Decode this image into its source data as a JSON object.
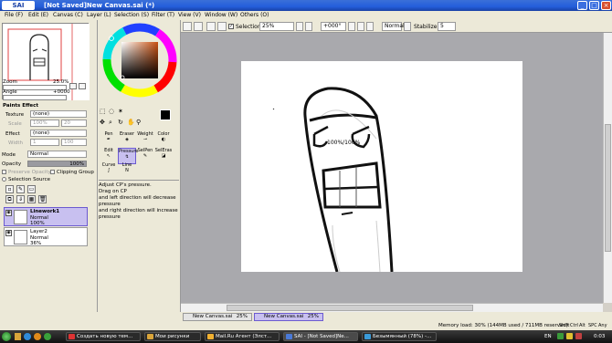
{
  "window": {
    "logo": "SAI",
    "title": "[Not Saved]New Canvas.sai (*)",
    "controls": [
      "_",
      "□",
      "×"
    ]
  },
  "menu": [
    "File (F)",
    "Edit (E)",
    "Canvas (C)",
    "Layer (L)",
    "Selection (S)",
    "Filter (T)",
    "View (V)",
    "Window (W)",
    "Others (O)"
  ],
  "navigator": {
    "zoom_label": "Zoom",
    "zoom_value": "25.0%",
    "angle_label": "Angle",
    "angle_value": "+0000"
  },
  "paint_effect": {
    "header": "Paints Effect",
    "texture_label": "Texture",
    "texture_value": "(none)",
    "scale_label": "Scale",
    "scale_value": "100%",
    "scale_num": "20",
    "effect_label": "Effect",
    "effect_value": "(none)",
    "width_label": "Width",
    "width_value": "1",
    "width_num": "100"
  },
  "layer_props": {
    "mode_label": "Mode",
    "mode_value": "Normal",
    "opacity_label": "Opacity",
    "opacity_value": "100%",
    "preserve_opacity": "Preserve Opacity",
    "clipping_group": "Clipping Group",
    "selection_source": "Selection Source"
  },
  "layers": [
    {
      "name": "Linework1",
      "mode": "Normal",
      "opacity": "100%",
      "selected": true
    },
    {
      "name": "Layer2",
      "mode": "Normal",
      "opacity": "36%",
      "selected": false
    }
  ],
  "tools": {
    "row1": [
      "Pen",
      "Eraser",
      "Weight",
      "Color"
    ],
    "row2": [
      "Edit",
      "Pressure",
      "SelPen",
      "SelEras"
    ],
    "row3": [
      "Curve",
      "Line"
    ],
    "help_text": "Adjust CP's pressure.\nDrag on CP\nand left direction will decrease pressure\nand right direction will increase pressure"
  },
  "toolbar": {
    "selection_label": "Selection",
    "zoom_value": "25%",
    "angle_value": "+000°",
    "mode_value": "Normal",
    "stabilizer_label": "Stabilizer",
    "stabilizer_value": "5"
  },
  "canvas": {
    "pressure_readout": "100%/100%"
  },
  "doc_tabs": [
    {
      "name": "New Canvas.sai",
      "zoom": "25%",
      "active": false
    },
    {
      "name": "New Canvas.sai",
      "zoom": "25%",
      "active": true
    }
  ],
  "status": {
    "memory": "Memory load: 30% (144MB used / 711MB reserved)",
    "keys": [
      "Shift",
      "Ctrl",
      "Alt",
      "SPC",
      "Any"
    ]
  },
  "taskbar": {
    "items": [
      "Создать новую тем...",
      "Мои рисунки",
      "Mail.Ru Агент (Элст...",
      "SAI - [Not Saved]Ne...",
      "Безымянный (78%) -..."
    ],
    "lang": "EN",
    "clock": "0:03"
  },
  "colors": {
    "accent": "#c8c0f0",
    "accent_border": "#6b5ad0",
    "canvas_bg": "#a9a9ad",
    "titlebar": "#245edb"
  }
}
